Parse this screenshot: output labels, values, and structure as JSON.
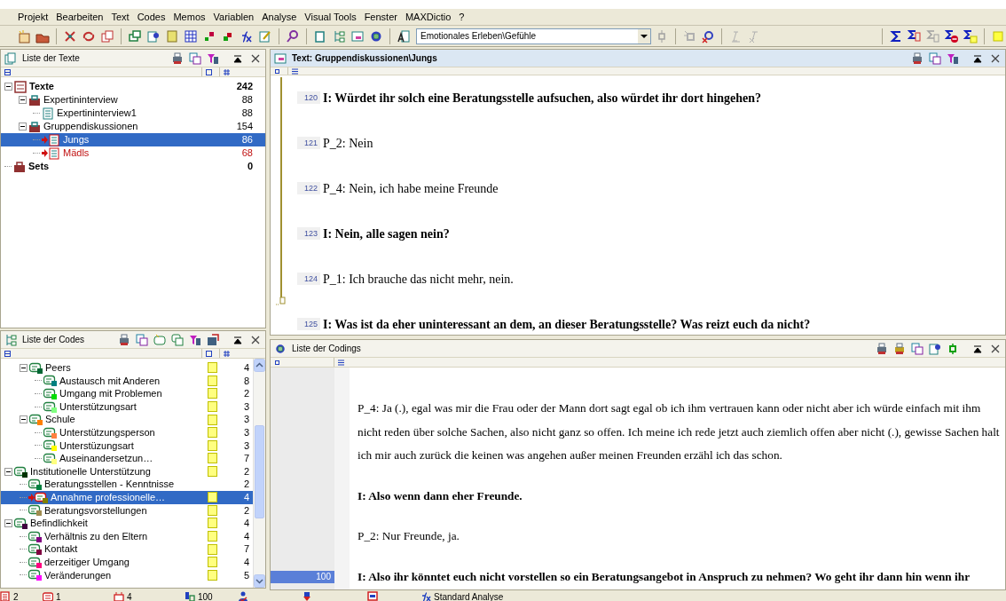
{
  "menu": [
    "Projekt",
    "Bearbeiten",
    "Text",
    "Codes",
    "Memos",
    "Variablen",
    "Analyse",
    "Visual Tools",
    "Fenster",
    "MAXDictio",
    "?"
  ],
  "toolbar": {
    "code_combo": "Emotionales Erleben\\Gefühle"
  },
  "texts_panel": {
    "title": "Liste der Texte",
    "tree": [
      {
        "kind": "root",
        "label": "Texte",
        "count": "242",
        "selected": false,
        "activated": false,
        "children": [
          {
            "kind": "group",
            "label": "Expertininterview",
            "count": "88",
            "selected": false,
            "activated": false,
            "children": [
              {
                "kind": "text",
                "label": "Expertininterview1",
                "count": "88",
                "selected": false,
                "activated": false
              }
            ]
          },
          {
            "kind": "group",
            "label": "Gruppendiskussionen",
            "count": "154",
            "selected": false,
            "activated": false,
            "children": [
              {
                "kind": "text",
                "label": "Jungs",
                "count": "86",
                "selected": true,
                "activated": true
              },
              {
                "kind": "text",
                "label": "Mädls",
                "count": "68",
                "selected": false,
                "activated": true
              }
            ]
          }
        ]
      },
      {
        "kind": "sets",
        "label": "Sets",
        "count": "0",
        "selected": false,
        "activated": false
      }
    ]
  },
  "codes_panel": {
    "title": "Liste der Codes",
    "tree": [
      {
        "children": [
          {
            "label": "Peers",
            "color": "#006633",
            "count": "4",
            "memo": true,
            "selected": false,
            "activated": false,
            "children": [
              {
                "label": "Austausch mit Anderen",
                "color": "#008080",
                "count": "8",
                "memo": true,
                "selected": false,
                "activated": false
              },
              {
                "label": "Umgang mit Problemen",
                "color": "#00dd00",
                "count": "2",
                "memo": true,
                "selected": false,
                "activated": false
              },
              {
                "label": "Unterstützungsart",
                "color": "#80ff80",
                "count": "3",
                "memo": true,
                "selected": false,
                "activated": false
              }
            ]
          },
          {
            "label": "Schule",
            "color": "#ff8000",
            "count": "3",
            "memo": true,
            "selected": false,
            "activated": false,
            "children": [
              {
                "label": "Unterstützungsperson",
                "color": "#ff8040",
                "count": "3",
                "memo": true,
                "selected": false,
                "activated": false
              },
              {
                "label": "Unterstüzungsart",
                "color": "#ffff00",
                "count": "3",
                "memo": true,
                "selected": false,
                "activated": false
              },
              {
                "label": "Auseinandersetzun…",
                "color": "#ffff80",
                "count": "7",
                "memo": true,
                "selected": false,
                "activated": false
              }
            ]
          }
        ]
      },
      {
        "label": "Institutionelle Unterstützung",
        "color": "#003300",
        "count": "2",
        "memo": true,
        "selected": false,
        "activated": false,
        "children": [
          {
            "label": "Beratungsstellen - Kenntnisse",
            "color": "#008040",
            "count": "2",
            "memo": false,
            "selected": false,
            "activated": false
          },
          {
            "label": "Annahme professionelle…",
            "color": "#808000",
            "count": "4",
            "memo": true,
            "selected": true,
            "activated": true
          },
          {
            "label": "Beratungsvorstellungen",
            "color": "#a08c50",
            "count": "2",
            "memo": true,
            "selected": false,
            "activated": false
          }
        ]
      },
      {
        "label": "Befindlichkeit",
        "color": "#400040",
        "count": "4",
        "memo": true,
        "selected": false,
        "activated": false,
        "children": [
          {
            "label": "Verhältnis zu den Eltern",
            "color": "#800080",
            "count": "4",
            "memo": true,
            "selected": false,
            "activated": false
          },
          {
            "label": "Kontakt",
            "color": "#800040",
            "count": "7",
            "memo": true,
            "selected": false,
            "activated": false
          },
          {
            "label": "derzeitiger Umgang",
            "color": "#ff0080",
            "count": "4",
            "memo": true,
            "selected": false,
            "activated": false
          },
          {
            "label": "Veränderungen",
            "color": "#ff00ff",
            "count": "5",
            "memo": true,
            "selected": false,
            "activated": false
          }
        ]
      }
    ]
  },
  "text_panel": {
    "title": "Text: Gruppendiskussionen\\Jungs",
    "lines": [
      {
        "number": "120",
        "kind": "interviewer",
        "text": "I: Würdet ihr solch eine Beratungsstelle aufsuchen, also würdet ihr dort hingehen?"
      },
      {
        "number": "121",
        "kind": "participant",
        "text": "P_2: Nein"
      },
      {
        "number": "122",
        "kind": "participant",
        "text": "P_4: Nein, ich habe meine Freunde"
      },
      {
        "number": "123",
        "kind": "interviewer",
        "text": "I: Nein, alle sagen nein?"
      },
      {
        "number": "124",
        "kind": "participant",
        "text": "P_1: Ich brauche das nicht mehr, nein."
      },
      {
        "number": "125",
        "kind": "interviewer",
        "text": "I: Was ist da eher uninteressant an dem, an dieser Beratungsstelle? Was reizt euch da nicht?"
      }
    ]
  },
  "codings_panel": {
    "title": "Liste der Codings",
    "paragraphs": [
      {
        "kind": "participant",
        "lines": [
          "P_4: Ja (.), egal was mir die Frau oder der Mann dort  sagt egal ob ich ihm vertrauen kann oder nicht aber ich würde einfach mit ihm",
          "nicht reden über solche Sachen, also nicht ganz so offen. Ich meine ich rede jetzt auch ziemlich offen aber nicht (.), gewisse Sachen halt",
          "ich mir auch zurück die keinen was angehen außer meinen Freunden erzähl ich das schon."
        ]
      },
      {
        "kind": "interviewer",
        "lines": [
          "I: Also wenn dann eher Freunde."
        ]
      },
      {
        "kind": "participant",
        "lines": [
          "P_2: Nur Freunde, ja."
        ]
      },
      {
        "kind": "interviewer",
        "relevance": "100",
        "lines": [
          "I: Also ihr könntet  euch nicht vorstellen so ein Beratungsangebot in Anspruch zu nehmen? Wo geht ihr dann hin wenn ihr"
        ]
      }
    ]
  },
  "status_bar": [
    {
      "kind": "texts",
      "value": "2"
    },
    {
      "kind": "memos",
      "value": "1"
    },
    {
      "kind": "codes",
      "value": "4"
    },
    {
      "kind": "weight",
      "value": "100"
    },
    {
      "kind": "user"
    },
    {
      "kind": "import"
    },
    {
      "kind": "window"
    },
    {
      "kind": "function",
      "value": "Standard Analyse"
    }
  ]
}
